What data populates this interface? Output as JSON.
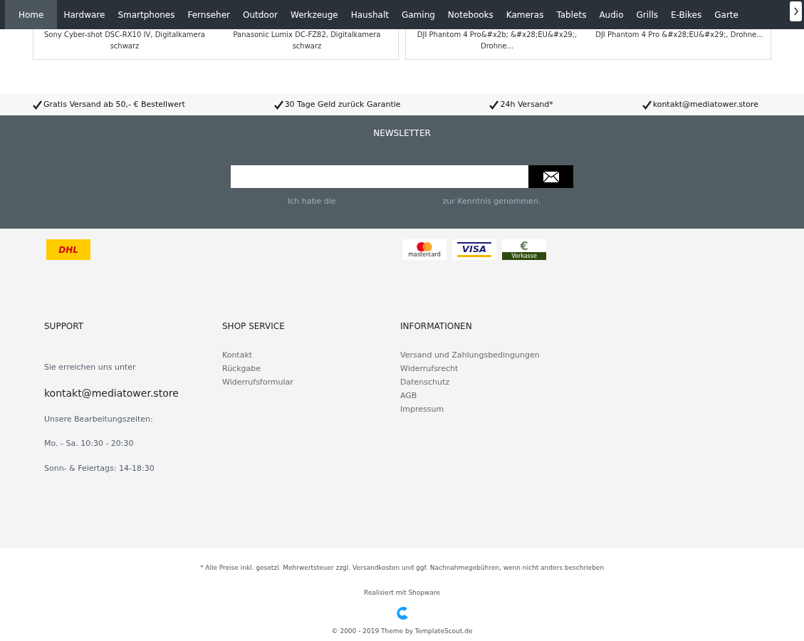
{
  "nav": {
    "items": [
      {
        "label": "Home",
        "selected": true
      },
      {
        "label": "Hardware",
        "selected": false
      },
      {
        "label": "Smartphones",
        "selected": false
      },
      {
        "label": "Fernseher",
        "selected": false
      },
      {
        "label": "Outdoor",
        "selected": false
      },
      {
        "label": "Werkzeuge",
        "selected": false
      },
      {
        "label": "Haushalt",
        "selected": false
      },
      {
        "label": "Gaming",
        "selected": false
      },
      {
        "label": "Notebooks",
        "selected": false
      },
      {
        "label": "Kameras",
        "selected": false
      },
      {
        "label": "Tablets",
        "selected": false
      },
      {
        "label": "Audio",
        "selected": false
      },
      {
        "label": "Grills",
        "selected": false
      },
      {
        "label": "E-Bikes",
        "selected": false
      },
      {
        "label": "Garte",
        "selected": false
      }
    ]
  },
  "product_cards": [
    {
      "products": [
        "Sony Cyber-shot DSC-RX10 IV, Digitalkamera schwarz",
        "Panasonic Lumix DC-FZ82, Digitalkamera schwarz"
      ]
    },
    {
      "products": [
        "DJI Phantom 4 Pro&#x2b; &#x28;EU&#x29;, Drohne...",
        "DJI Phantom 4 Pro &#x28;EU&#x29;, Drohne..."
      ]
    }
  ],
  "usps": [
    "Gratis Versand ab 50,- € Bestellwert",
    "30 Tage Geld zurück Garantie",
    "24h Versand*",
    "kontakt@mediatower.store"
  ],
  "newsletter": {
    "title": "NEWSLETTER",
    "consent_before": "Ich habe die",
    "consent_after": "zur Kenntnis genommen."
  },
  "shipping_logo": {
    "text": "DHL"
  },
  "payment_logos": [
    {
      "kind": "mastercard",
      "text": "mastercard"
    },
    {
      "kind": "visa",
      "text": "VISA"
    },
    {
      "kind": "prepayment",
      "symbol": "€",
      "text": "Vorkasse"
    }
  ],
  "support": {
    "title": "SUPPORT",
    "intro": "Sie erreichen uns unter",
    "email": "kontakt@mediatower.store",
    "lines": [
      "Unsere Bearbeitungszeiten:",
      "Mo. - Sa. 10:30 - 20:30",
      "Sonn- & Feiertags: 14-18:30"
    ]
  },
  "shop_service": {
    "title": "SHOP SERVICE",
    "links": [
      "Kontakt",
      "Rückgabe",
      "Widerrufsformular"
    ]
  },
  "informationen": {
    "title": "INFORMATIONEN",
    "links": [
      "Versand und Zahlungsbedingungen",
      "Widerrufsrecht",
      "Datenschutz",
      "AGB",
      "Impressum"
    ]
  },
  "bottom": {
    "tax_note": "* Alle Preise inkl. gesetzl. Mehrwertsteuer zzgl. Versandkosten und ggf. Nachnahmegebühren, wenn nicht anders beschrieben",
    "powered_by": "Realisiert mit Shopware",
    "copyright": "© 2000 - 2019 Theme by TemplateScout.de"
  }
}
